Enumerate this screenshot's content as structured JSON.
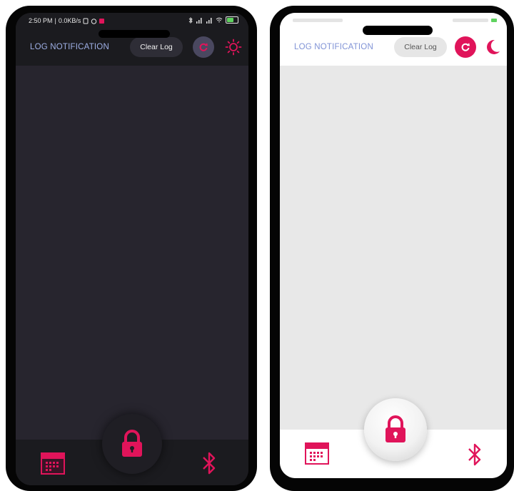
{
  "dark": {
    "status": {
      "time": "2:50 PM",
      "speed": "0.0KB/s"
    },
    "header": {
      "title": "LOG NOTIFICATION",
      "clear_label": "Clear Log"
    }
  },
  "light": {
    "header": {
      "title": "LOG NOTIFICATION",
      "clear_label": "Clear Log"
    }
  },
  "colors": {
    "accent": "#e0145a",
    "dark_screen": "#27252e",
    "dark_bar": "#1b1b1f",
    "light_screen": "#e8e8e8",
    "title_blue_dark": "#9fb0e6",
    "title_blue_light": "#8093d6"
  },
  "icons": {
    "sync": "sync-icon",
    "sun": "sun-icon",
    "moon": "moon-icon",
    "lock": "lock-icon",
    "calendar": "calendar-icon",
    "bluetooth": "bluetooth-icon"
  }
}
